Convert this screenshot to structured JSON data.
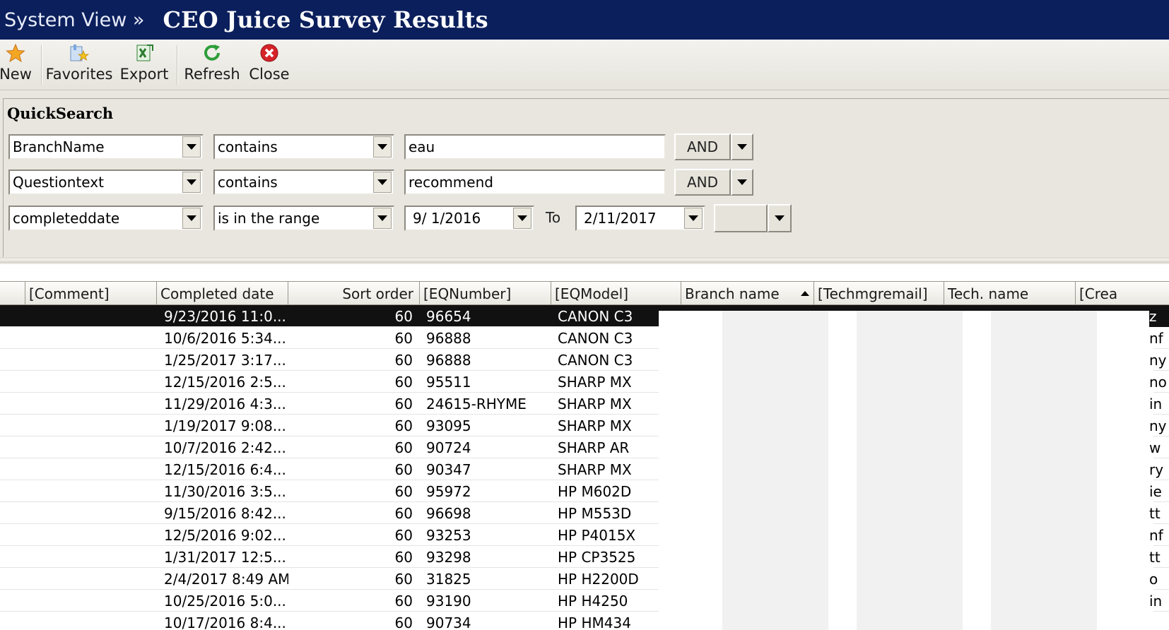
{
  "header": {
    "breadcrumb": "System View »",
    "title": "CEO Juice Survey Results"
  },
  "toolbar": {
    "buttons": [
      {
        "label": "New",
        "icon": "star-icon"
      },
      {
        "label": "Favorites",
        "icon": "favorites-icon"
      },
      {
        "label": "Export",
        "icon": "export-excel-icon"
      },
      {
        "label": "Refresh",
        "icon": "refresh-icon"
      },
      {
        "label": "Close",
        "icon": "close-icon"
      }
    ]
  },
  "quicksearch": {
    "title": "QuickSearch",
    "rows": [
      {
        "field": "BranchName",
        "operator": "contains",
        "value": "eau",
        "logic": "AND"
      },
      {
        "field": "Questiontext",
        "operator": "contains",
        "value": "recommend",
        "logic": "AND"
      },
      {
        "field": "completeddate",
        "operator": "is in the range",
        "from": "9/ 1/2016",
        "to_label": "To",
        "to": "2/11/2017",
        "logic": ""
      }
    ]
  },
  "grid": {
    "columns": [
      "[Comment]",
      "Completed date",
      "Sort order",
      "[EQNumber]",
      "[EQModel]",
      "Branch name",
      "[Techmgremail]",
      "Tech. name",
      "[Crea"
    ],
    "rows": [
      {
        "completed": "9/23/2016 11:0...",
        "sort": "60",
        "eqnumber": "96654",
        "eqmodel": "CANON C3",
        "tail": "z"
      },
      {
        "completed": "10/6/2016 5:34...",
        "sort": "60",
        "eqnumber": "96888",
        "eqmodel": "CANON C3",
        "tail": "nf"
      },
      {
        "completed": "1/25/2017 3:17...",
        "sort": "60",
        "eqnumber": "96888",
        "eqmodel": "CANON C3",
        "tail": "ny"
      },
      {
        "completed": "12/15/2016 2:5...",
        "sort": "60",
        "eqnumber": "95511",
        "eqmodel": "SHARP MX",
        "tail": "no"
      },
      {
        "completed": "11/29/2016 4:3...",
        "sort": "60",
        "eqnumber": "24615-RHYME",
        "eqmodel": "SHARP MX",
        "tail": "in"
      },
      {
        "completed": "1/19/2017 9:08...",
        "sort": "60",
        "eqnumber": "93095",
        "eqmodel": "SHARP MX",
        "tail": "ny"
      },
      {
        "completed": "10/7/2016 2:42...",
        "sort": "60",
        "eqnumber": "90724",
        "eqmodel": "SHARP AR",
        "tail": "w"
      },
      {
        "completed": "12/15/2016 6:4...",
        "sort": "60",
        "eqnumber": "90347",
        "eqmodel": "SHARP MX",
        "tail": "ry"
      },
      {
        "completed": "11/30/2016 3:5...",
        "sort": "60",
        "eqnumber": "95972",
        "eqmodel": "HP M602D",
        "tail": "ie"
      },
      {
        "completed": "9/15/2016 8:42...",
        "sort": "60",
        "eqnumber": "96698",
        "eqmodel": "HP M553D",
        "tail": "tt"
      },
      {
        "completed": "12/5/2016 9:02...",
        "sort": "60",
        "eqnumber": "93253",
        "eqmodel": "HP P4015X",
        "tail": "nf"
      },
      {
        "completed": "1/31/2017 12:5...",
        "sort": "60",
        "eqnumber": "93298",
        "eqmodel": "HP CP3525",
        "tail": "tt"
      },
      {
        "completed": "2/4/2017 8:49 AM",
        "sort": "60",
        "eqnumber": "31825",
        "eqmodel": "HP H2200D",
        "tail": "o"
      },
      {
        "completed": "10/25/2016 5:0...",
        "sort": "60",
        "eqnumber": "93190",
        "eqmodel": "HP H4250",
        "tail": "in"
      },
      {
        "completed": "10/17/2016 8:4...",
        "sort": "60",
        "eqnumber": "90734",
        "eqmodel": "HP HM434",
        "tail": ""
      }
    ]
  },
  "colors": {
    "titlebar": "#0b1f5c",
    "selected_row": "#111111",
    "panel": "#e8e6df"
  }
}
